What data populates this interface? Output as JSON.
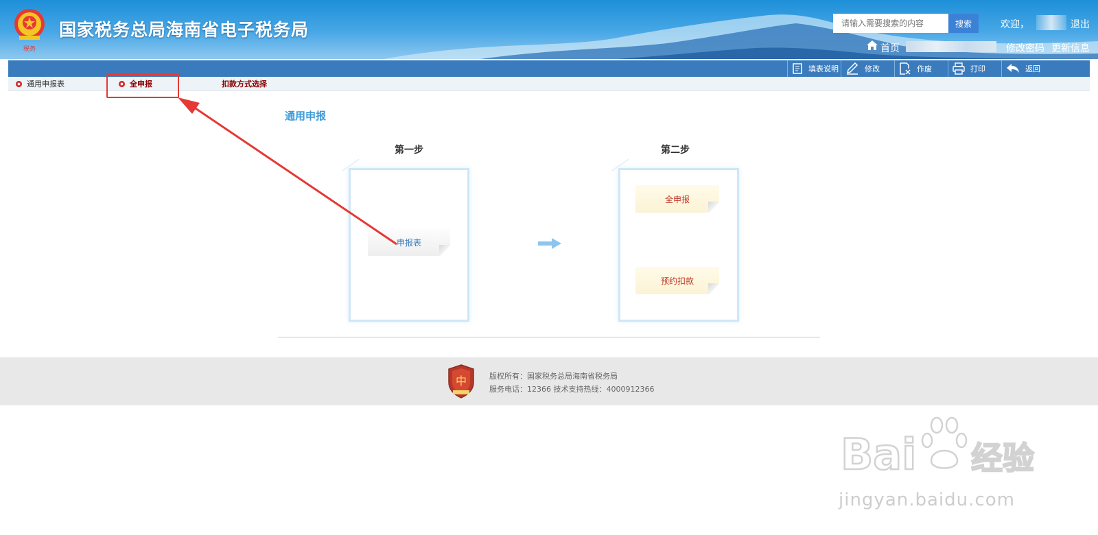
{
  "header": {
    "site_title": "国家税务总局海南省电子税务局",
    "search": {
      "placeholder": "请输入需要搜索的内容",
      "button_label": "搜索"
    },
    "welcome": "欢迎，",
    "logout": "退出",
    "home": "首页",
    "change_password": "修改密码",
    "update_info": "更新信息"
  },
  "toolbar": {
    "items": [
      {
        "label": "填表说明",
        "icon": "doc-lines-icon"
      },
      {
        "label": "修改",
        "icon": "pencil-icon"
      },
      {
        "label": "作废",
        "icon": "doc-x-icon"
      },
      {
        "label": "打印",
        "icon": "printer-icon"
      },
      {
        "label": "返回",
        "icon": "back-arrow-icon"
      }
    ]
  },
  "tabs": [
    {
      "label": "通用申报表",
      "icon": "gear-icon"
    },
    {
      "label": "全申报",
      "icon": "gear-icon"
    },
    {
      "label": "扣款方式选择"
    }
  ],
  "main": {
    "section_title": "通用申报",
    "step1": {
      "label": "第一步",
      "note": "申报表"
    },
    "step2": {
      "label": "第二步",
      "note_full": "全申报",
      "note_payment": "预约扣款"
    }
  },
  "footer": {
    "copyright": "版权所有：国家税务总局海南省税务局",
    "contact": "服务电话：12366 技术支持热线：4000912366"
  },
  "watermark": {
    "url": "jingyan.baidu.com"
  },
  "colors": {
    "header_blue": "#1d8fd8",
    "toolbar_blue": "#3a7bbd",
    "title_blue": "#3a9ad9",
    "dark_red": "#8b0000",
    "annotation_red": "#e53935"
  }
}
